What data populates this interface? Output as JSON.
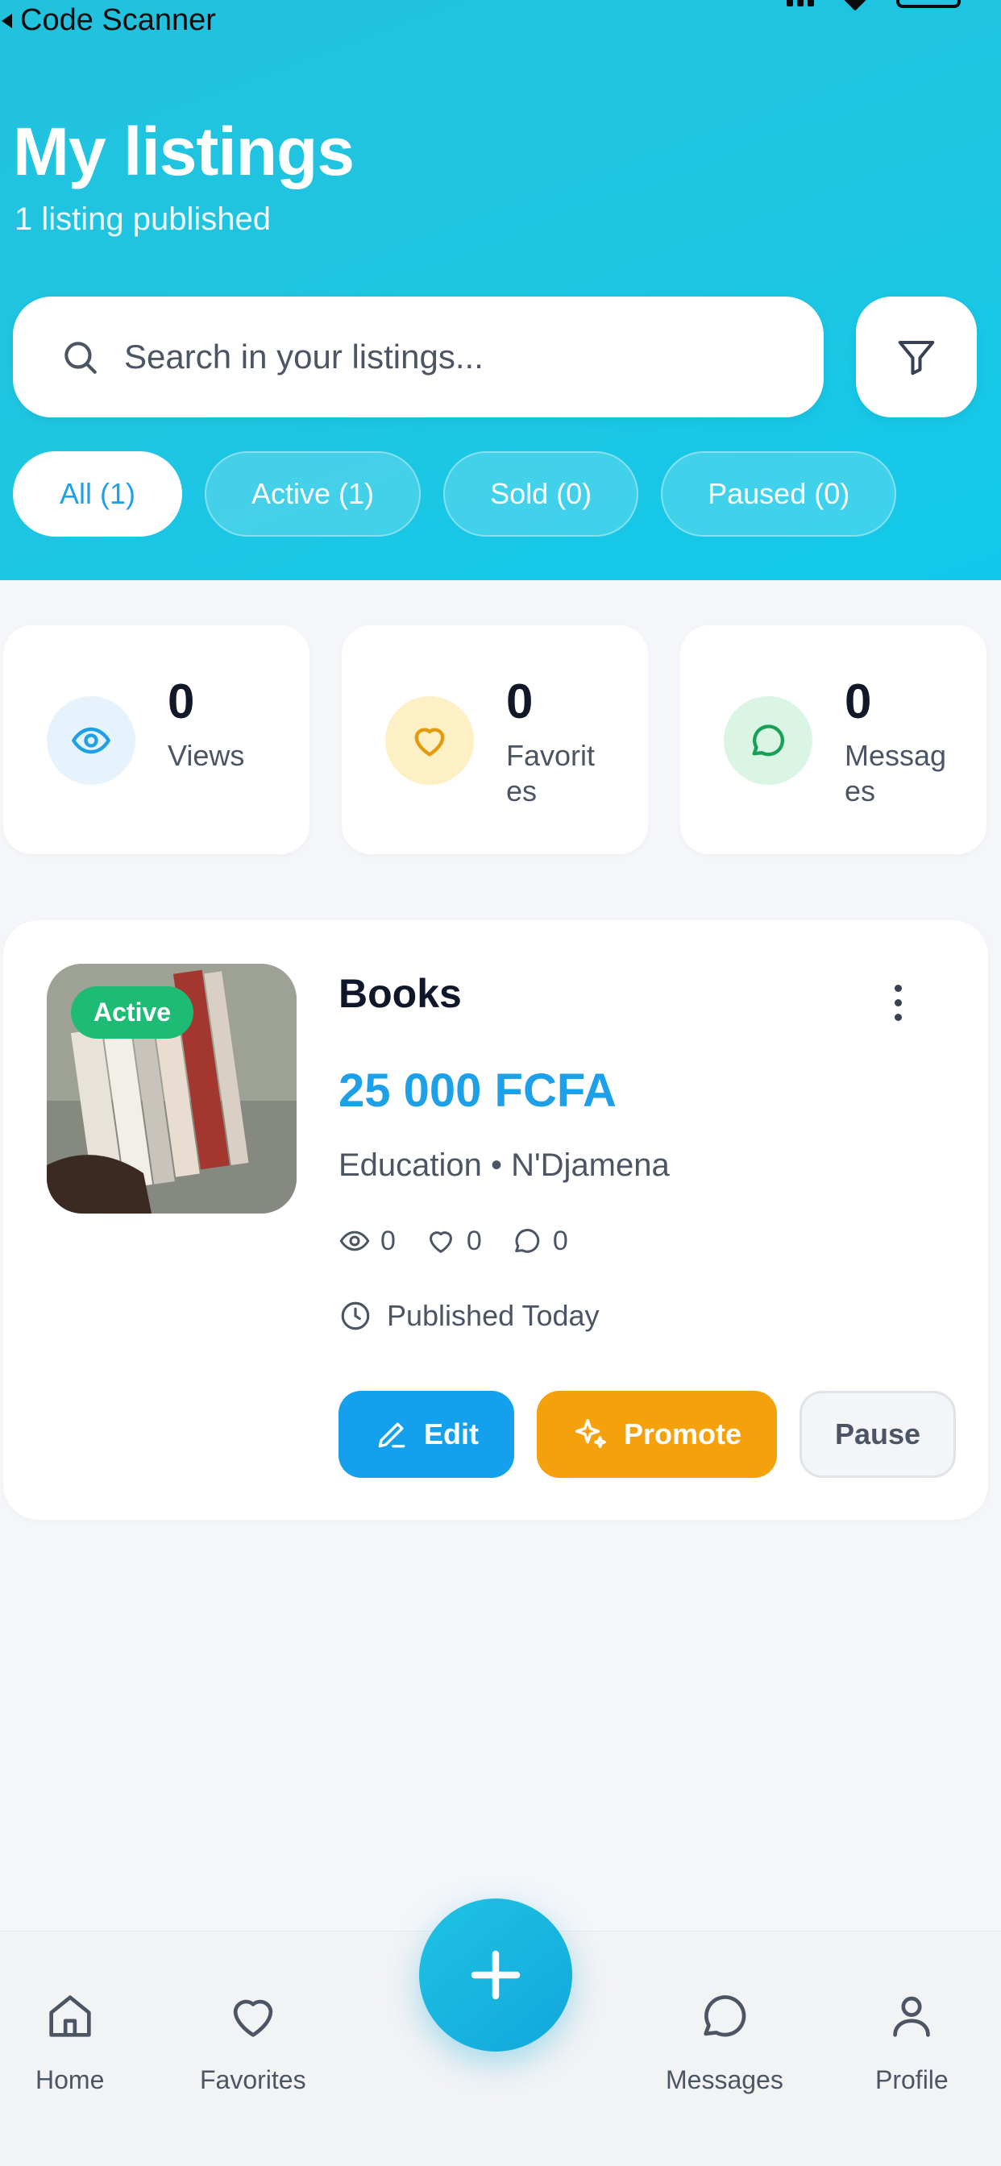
{
  "statusbar": {
    "back_label": "Code Scanner"
  },
  "header": {
    "title": "My listings",
    "subtitle": "1 listing published",
    "search": {
      "placeholder": "Search in your listings..."
    },
    "filter_icon": "filter-icon",
    "chips": [
      {
        "label": "All (1)",
        "selected": true
      },
      {
        "label": "Active (1)",
        "selected": false
      },
      {
        "label": "Sold (0)",
        "selected": false
      },
      {
        "label": "Paused (0)",
        "selected": false
      }
    ]
  },
  "stats": [
    {
      "value": "0",
      "label": "Views",
      "icon": "eye-icon",
      "color": "#1ea0e8"
    },
    {
      "value": "0",
      "label": "Favorites",
      "icon": "heart-icon",
      "color": "#e59a0e"
    },
    {
      "value": "0",
      "label": "Messages",
      "icon": "chat-icon",
      "color": "#17a058"
    }
  ],
  "listing": {
    "status": "Active",
    "title": "Books",
    "price": "25 000 FCFA",
    "meta": "Education • N'Djamena",
    "views": "0",
    "favorites": "0",
    "messages": "0",
    "published": "Published Today",
    "actions": {
      "edit": "Edit",
      "promote": "Promote",
      "pause": "Pause"
    }
  },
  "nav": {
    "home": "Home",
    "favorites": "Favorites",
    "messages": "Messages",
    "profile": "Profile"
  },
  "colors": {
    "accent": "#1ea0e8",
    "header_gradient": "#1ec6e2",
    "active_badge": "#1dbb74",
    "promote": "#f5a10c"
  }
}
